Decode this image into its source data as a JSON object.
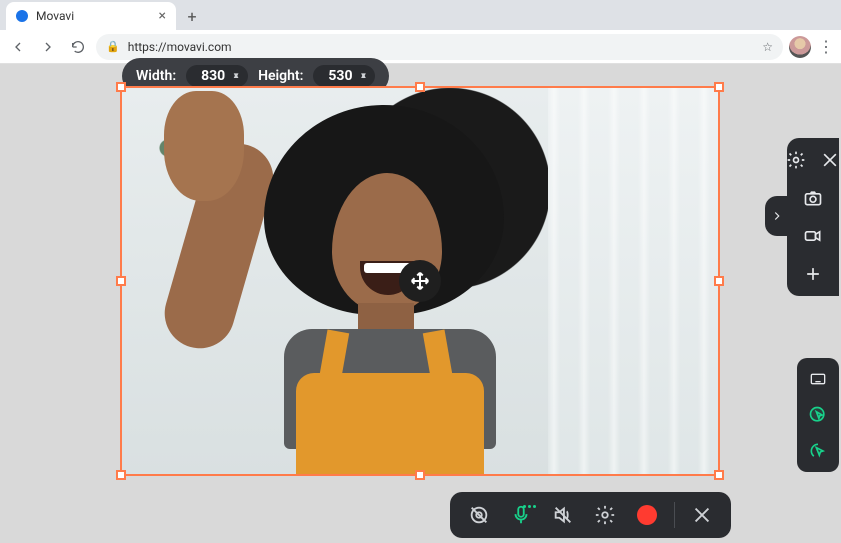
{
  "browser": {
    "tab_title": "Movavi",
    "url": "https://movavi.com"
  },
  "capture": {
    "width_label": "Width:",
    "height_label": "Height:",
    "width": "830",
    "height": "530"
  },
  "side_tools": {
    "settings": "settings",
    "close": "close",
    "screenshot": "screenshot",
    "record_video": "record-video",
    "add": "add"
  },
  "cursor_tools": {
    "keyboard": "keyboard-overlay",
    "highlight_cursor": "highlight-cursor",
    "highlight_clicks": "highlight-clicks"
  },
  "controls": {
    "webcam": "toggle-webcam",
    "mic": "toggle-microphone",
    "system_audio": "toggle-system-audio",
    "settings": "recorder-settings",
    "record": "start-recording",
    "cancel": "cancel"
  }
}
